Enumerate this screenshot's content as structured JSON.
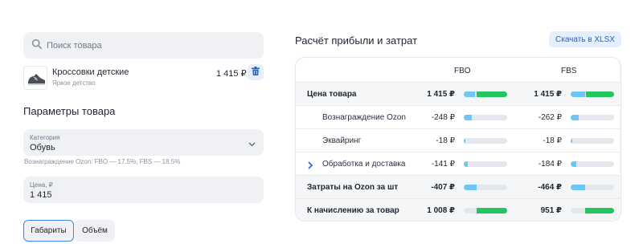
{
  "search": {
    "placeholder": "Поиск товара"
  },
  "product": {
    "name": "Кроссовки детские",
    "brand": "Яркое детство",
    "price": "1 415 ₽"
  },
  "params": {
    "title": "Параметры товара",
    "category": {
      "label": "Категория",
      "value": "Обувь"
    },
    "commission_hint": "Вознаграждение Ozon: FBO — 17.5%, FBS — 18.5%",
    "price": {
      "label": "Цена, ₽",
      "value": "1 415"
    },
    "tabs": [
      {
        "label": "Габариты",
        "active": true
      },
      {
        "label": "Объём",
        "active": false
      }
    ]
  },
  "calc": {
    "title": "Расчёт прибыли и затрат",
    "download_label": "Скачать в XLSX",
    "columns": [
      "FBO",
      "FBS"
    ],
    "rows": [
      {
        "label": "Цена товара",
        "style": "bold",
        "fbo": "1 415 ₽",
        "fbs": "1 415 ₽",
        "fbo_cost": 0.26,
        "fbo_profit": 0.7,
        "fbs_cost": 0.33,
        "fbs_profit": 0.65
      },
      {
        "label": "Вознаграждение Ozon",
        "style": "sub",
        "fbo": "-248 ₽",
        "fbs": "-262 ₽",
        "fbo_cost": 0.18,
        "fbs_cost": 0.19
      },
      {
        "label": "Эквайринг",
        "style": "sub",
        "fbo": "-18 ₽",
        "fbs": "-18 ₽",
        "fbo_cost": 0.02,
        "fbs_cost": 0.02
      },
      {
        "label": "Обработка и доставка",
        "style": "sub-expand",
        "fbo": "-141 ₽",
        "fbs": "-184 ₽",
        "fbo_cost": 0.1,
        "fbs_cost": 0.13
      },
      {
        "label": "Затраты на Ozon за шт",
        "style": "bold",
        "fbo": "-407 ₽",
        "fbs": "-464 ₽",
        "fbo_cost": 0.29,
        "fbs_cost": 0.33
      },
      {
        "label": "К начислению за товар",
        "style": "bold",
        "fbo": "1 008 ₽",
        "fbs": "951 ₽",
        "fbo_profit": 0.71,
        "fbs_profit": 0.67
      }
    ]
  },
  "colors": {
    "accent": "#3b86ec",
    "cost_bar": "#6ec6f5",
    "profit_bar": "#23c55e",
    "field_bg": "#eff1f5"
  }
}
